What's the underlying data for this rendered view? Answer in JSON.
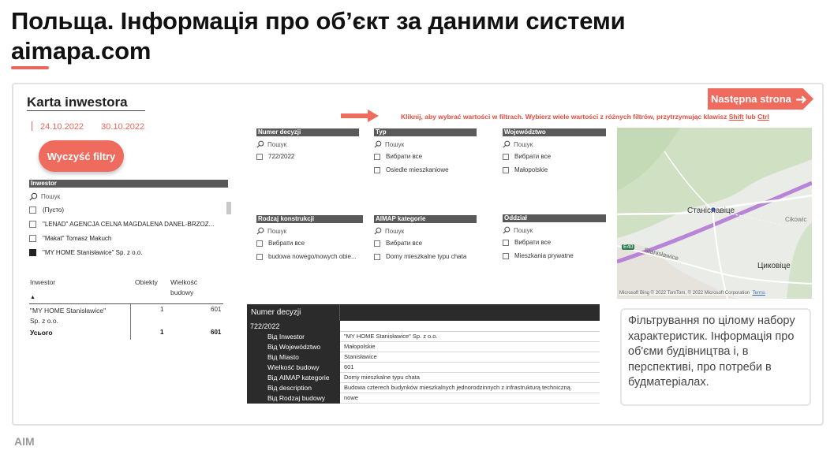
{
  "slide": {
    "title_line1": "Польща. Інформація про об’єкт за даними системи",
    "title_line2": "aimapa.com",
    "footer_brand": "AIM"
  },
  "report": {
    "title": "Karta inwestora",
    "date_from": "24.10.2022",
    "date_to": "30.10.2022",
    "clear_filters": "Wyczyść filtry",
    "next_page": "Następna strona",
    "hint_prefix": "Kliknij, aby wybrać wartości w filtrach. Wybierz wiele wartości z różnych filtrów, przytrzymując klawisz ",
    "hint_shift": "Shift",
    "hint_mid": " lub ",
    "hint_ctrl": "Ctrl"
  },
  "investor_slicer": {
    "header": "Inwestor",
    "search_placeholder": "Пошук",
    "options": [
      {
        "label": "(Пусто)",
        "checked": false
      },
      {
        "label": "\"LENAD\" AGENCJA CELNA MAGDALENA DANEL-BRZOZ...",
        "checked": false
      },
      {
        "label": "\"Makat\" Tomasz Makuch",
        "checked": false
      },
      {
        "label": "\"MY HOME Stanisławice\" Sp. z o.o.",
        "checked": true
      }
    ]
  },
  "slicers": {
    "numer_decyzji": {
      "header": "Numer decyzji",
      "search": "Пошук",
      "options": [
        "722/2022"
      ]
    },
    "typ": {
      "header": "Typ",
      "search": "Пошук",
      "options": [
        "Вибрати все",
        "Osiedle mieszkaniowe"
      ]
    },
    "wojewodztwo": {
      "header": "Województwo",
      "search": "Пошук",
      "options": [
        "Вибрати все",
        "Małopolskie"
      ]
    },
    "rodzaj": {
      "header": "Rodzaj konstrukcji",
      "search": "Пошук",
      "options": [
        "Вибрати все",
        "budowa nowego/nowych obie..."
      ]
    },
    "aimap": {
      "header": "AIMAP kategorie",
      "search": "Пошук",
      "options": [
        "Вибрати все",
        "Domy mieszkalne typu chata"
      ]
    },
    "oddzial": {
      "header": "Oddział",
      "search": "Пошук",
      "options": [
        "Вибрати все",
        "Mieszkania prywatne"
      ]
    }
  },
  "investor_table": {
    "col_investor": "Inwestor",
    "col_objects": "Obiekty",
    "col_size_1": "Wielkość",
    "col_size_2": "budowy",
    "row_name_1": "\"MY HOME Stanisławice\"",
    "row_name_2": "Sp. z o.o.",
    "row_objects": "1",
    "row_size": "601",
    "total_label": "Усього",
    "total_objects": "1",
    "total_size": "601"
  },
  "map": {
    "label_town": "Станіславіце",
    "label_cikowice": "Cikowic",
    "label_stanislawice": "Stanisławice",
    "label_tsykovytse": "Циковіце",
    "road_badge": "E40",
    "credit": "Microsoft Bing © 2022 TomTom, © 2022 Microsoft Corporation",
    "credit_link": "Terms"
  },
  "info_box": {
    "text": "Фільтрування по цілому набору характеристик. Інформація про об'єми будівництва і, в перспективі, про потреби в будматеріалах."
  },
  "details": {
    "header": "Numer decyzji",
    "decision": "722/2022",
    "rows": [
      {
        "label": "Від Inwestor",
        "value": "\"MY HOME Stanisławice\" Sp. z o.o."
      },
      {
        "label": "Від Województwo",
        "value": "Małopolskie"
      },
      {
        "label": "Від Miasto",
        "value": "Stanisławice"
      },
      {
        "label": "Wielkość budowy",
        "value": "601"
      },
      {
        "label": "Від AIMAP kategorie",
        "value": "Domy mieszkalne typu chata"
      },
      {
        "label": "Від description",
        "value": "Budowa czterech budynków mieszkalnych jednorodzinnych z infrastrukturą techniczną."
      },
      {
        "label": "Від Rodzaj budowy",
        "value": "nowe"
      }
    ]
  },
  "colors": {
    "accent": "#ef6b5d",
    "dark_header": "#2b2b2b",
    "slicer_header": "#595959",
    "route": "#b884d6"
  }
}
